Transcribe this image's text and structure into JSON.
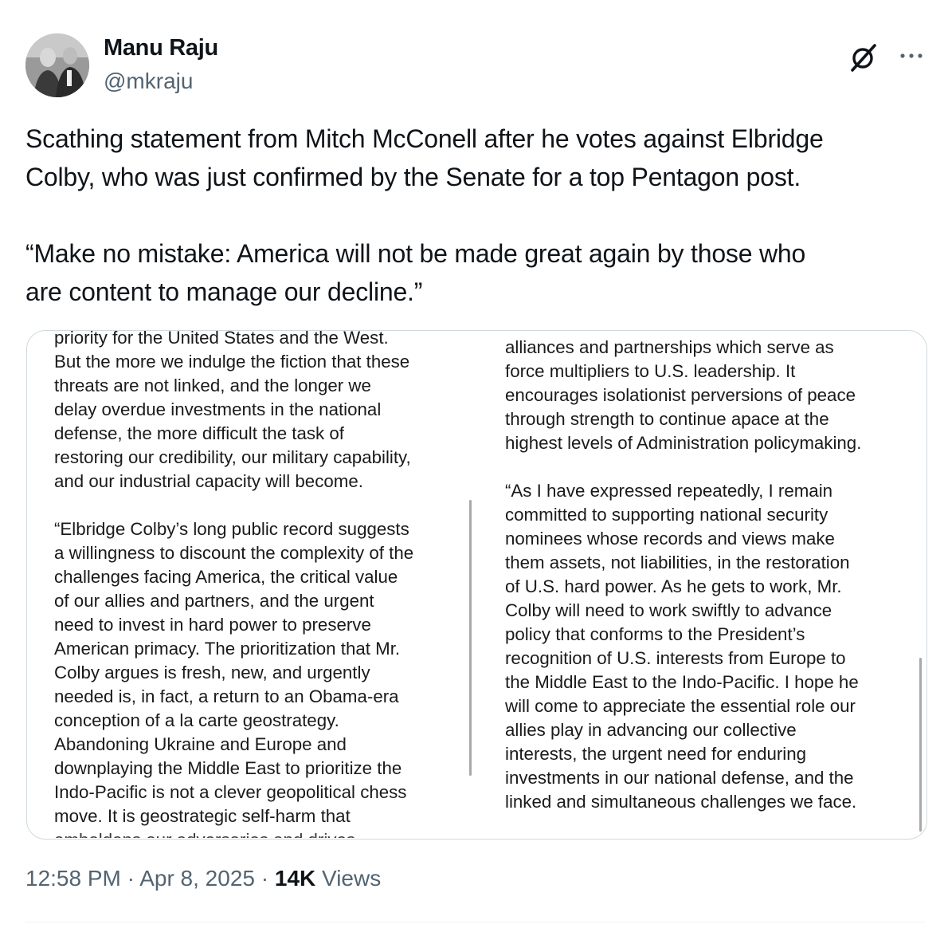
{
  "author": {
    "name": "Manu Raju",
    "handle": "@mkraju"
  },
  "icons": {
    "grok": "grok-icon",
    "more": "more-icon"
  },
  "tweet": {
    "paragraph_1": "Scathing statement from Mitch McConell after he votes against Elbridge\nColby, who was just confirmed by the Senate for a top Pentagon post.",
    "paragraph_2": "“Make no mistake: America will not be made great again by those who\nare content to manage our decline.”"
  },
  "statement_image": {
    "left_column": {
      "lines": [
        "priority for the United States and the West.",
        "But the more we indulge the fiction that these",
        "threats are not linked, and the longer we",
        "delay overdue investments in the national",
        "defense, the more difficult the task of",
        "restoring our credibility, our military capability,",
        "and our industrial capacity will become.",
        "",
        "“Elbridge Colby’s long public record suggests",
        "a willingness to discount the complexity of the",
        "challenges facing America, the critical value",
        "of our allies and partners, and the urgent",
        "need to invest in hard power to preserve",
        "American primacy. The prioritization that Mr.",
        "Colby argues is fresh, new, and urgently",
        "needed is, in fact, a return to an Obama-era",
        "conception of a la carte geostrategy.",
        "Abandoning Ukraine and Europe and",
        "downplaying the Middle East to prioritize the",
        "Indo-Pacific is not a clever geopolitical chess",
        "move. It is geostrategic self-harm that"
      ],
      "cut_line": "emboldens our adversaries and drives"
    },
    "right_column": {
      "lines": [
        "alliances and partnerships which serve as",
        "force multipliers to U.S. leadership. It",
        "encourages isolationist perversions of peace",
        "through strength to continue apace at the",
        "highest levels of Administration policymaking.",
        "",
        "“As I have expressed repeatedly, I remain",
        "committed to supporting national security",
        "nominees whose records and views make",
        "them assets, not liabilities, in the restoration",
        "of U.S. hard power. As he gets to work, Mr.",
        "Colby will need to work swiftly to advance",
        "policy that conforms to the President’s",
        "recognition of U.S. interests from Europe to",
        "the Middle East to the Indo-Pacific. I hope he",
        "will come to appreciate the essential role our",
        "allies play in advancing our collective",
        "interests, the urgent need for enduring",
        "investments in our national defense, and the",
        "linked and simultaneous challenges we face."
      ]
    }
  },
  "meta": {
    "time": "12:58 PM",
    "separator_1": " · ",
    "date": "Apr 8, 2025",
    "separator_2": " · ",
    "views_count": "14K",
    "views_label": " Views"
  }
}
